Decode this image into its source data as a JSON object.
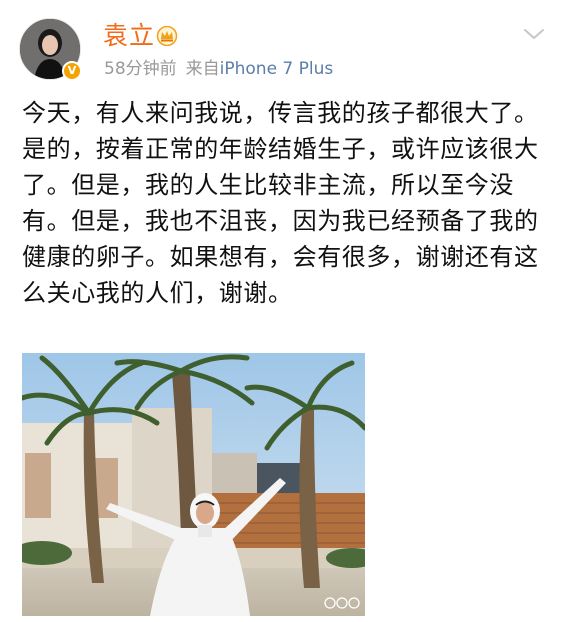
{
  "post": {
    "author": {
      "name": "袁立",
      "verified": true,
      "verified_badge_symbol": "V",
      "vip_icon": "crown-icon"
    },
    "meta": {
      "time": "58分钟前",
      "source_label": "来自",
      "device": "iPhone 7 Plus"
    },
    "menu_icon": "chevron-down-icon",
    "text": "今天，有人来问我说，传言我的孩子都很大了。是的，按着正常的年龄结婚生子，或许应该很大了。但是，我的人生比较非主流，所以至今没有。但是，我也不沮丧，因为我已经预备了我的健康的卵子。如果想有，会有很多，谢谢还有这么关心我的人们，谢谢。",
    "image": {
      "watermark_icon": "weibo-watermark-icon"
    }
  },
  "colors": {
    "username": "#f26a1b",
    "meta": "#999999",
    "device_link": "#5b7ea8",
    "text": "#111111",
    "verified_badge": "#f4a300"
  }
}
